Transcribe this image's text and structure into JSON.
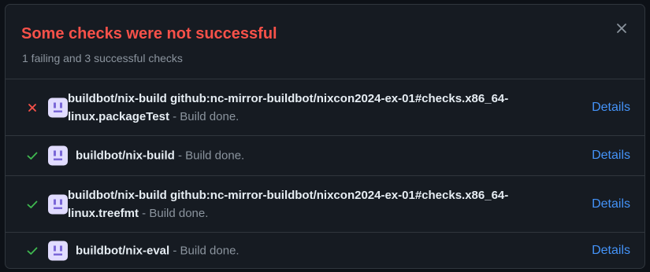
{
  "header": {
    "title": "Some checks were not successful",
    "subtitle": "1 failing and 3 successful checks",
    "close_icon": "close-icon"
  },
  "checks": [
    {
      "status": "failure",
      "status_icon": "x-icon",
      "name": "buildbot/nix-build github:nc-mirror-buildbot/nixcon2024-ex-01#checks.x86_64-linux.packageTest",
      "description": " - Build done.",
      "details_label": "Details"
    },
    {
      "status": "success",
      "status_icon": "check-icon",
      "name": "buildbot/nix-build",
      "description": " - Build done.",
      "details_label": "Details"
    },
    {
      "status": "success",
      "status_icon": "check-icon",
      "name": "buildbot/nix-build github:nc-mirror-buildbot/nixcon2024-ex-01#checks.x86_64-linux.treefmt",
      "description": " - Build done.",
      "details_label": "Details"
    },
    {
      "status": "success",
      "status_icon": "check-icon",
      "name": "buildbot/nix-eval",
      "description": " - Build done.",
      "details_label": "Details"
    }
  ],
  "colors": {
    "failure": "#f85149",
    "success": "#3fb950",
    "link": "#4493f8",
    "avatar_bg": "#e1dcff",
    "avatar_fg": "#7b68d8"
  }
}
